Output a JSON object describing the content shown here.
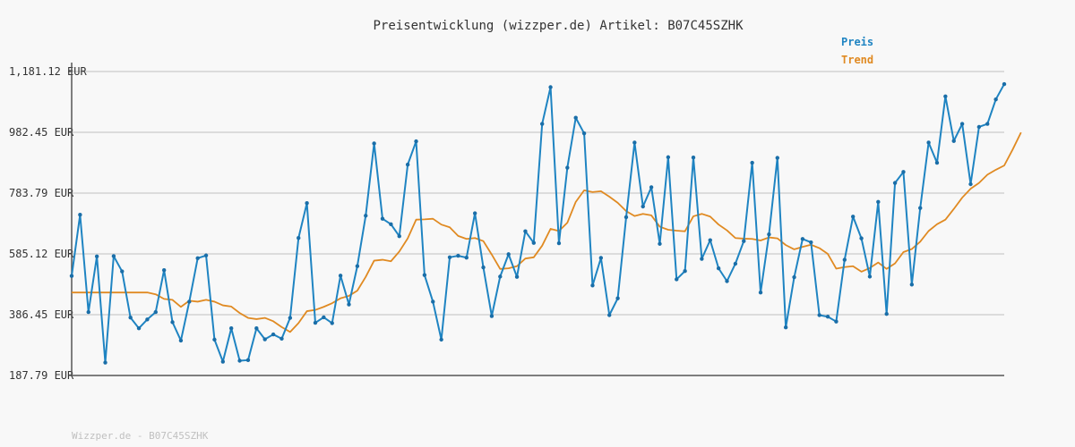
{
  "chart_data": {
    "type": "line",
    "title": "Preisentwicklung (wizzper.de) Artikel: B07C45SZHK",
    "xlabel": "",
    "ylabel": "",
    "ylim": [
      187.79,
      1181.12
    ],
    "yticks": [
      "1,181.12 EUR",
      "982.45 EUR",
      "783.79 EUR",
      "585.12 EUR",
      "386.45 EUR",
      "187.79 EUR"
    ],
    "grid": true,
    "legend": "top-right",
    "footer": "Wizzper.de - B07C45SZHK",
    "series": [
      {
        "name": "Preis",
        "color": "#1f84c2",
        "values": [
          513,
          713,
          395,
          577,
          230,
          578,
          528,
          377,
          342,
          371,
          395,
          532,
          362,
          302,
          429,
          571,
          580,
          305,
          233,
          342,
          236,
          238,
          342,
          306,
          322,
          308,
          376,
          637,
          751,
          360,
          378,
          359,
          514,
          420,
          545,
          710,
          946,
          700,
          682,
          643,
          877,
          953,
          516,
          429,
          305,
          574,
          579,
          573,
          718,
          541,
          382,
          511,
          584,
          510,
          659,
          621,
          1010,
          1130,
          620,
          867,
          1030,
          979,
          482,
          572,
          385,
          440,
          705,
          949,
          740,
          803,
          618,
          901,
          502,
          529,
          900,
          569,
          630,
          538,
          496,
          553,
          627,
          883,
          459,
          649,
          899,
          345,
          509,
          634,
          623,
          385,
          380,
          364,
          566,
          707,
          636,
          511,
          755,
          389,
          817,
          853,
          485,
          735,
          949,
          883,
          1100,
          954,
          1010,
          813,
          1000,
          1010,
          1090,
          1140
        ]
      },
      {
        "name": "Trend",
        "color": "#e08a22",
        "values": [
          459,
          459,
          459,
          459,
          459,
          459,
          459,
          459,
          459,
          459,
          453,
          438,
          435,
          412,
          432,
          429,
          435,
          429,
          417,
          413,
          392,
          376,
          372,
          376,
          365,
          346,
          330,
          359,
          398,
          402,
          412,
          424,
          440,
          448,
          465,
          510,
          563,
          566,
          561,
          593,
          636,
          697,
          698,
          700,
          681,
          672,
          644,
          634,
          637,
          627,
          583,
          536,
          538,
          545,
          570,
          574,
          612,
          667,
          660,
          687,
          755,
          793,
          787,
          790,
          772,
          752,
          725,
          709,
          716,
          711,
          674,
          664,
          661,
          659,
          708,
          716,
          707,
          681,
          662,
          637,
          635,
          634,
          629,
          639,
          636,
          614,
          600,
          608,
          615,
          604,
          585,
          537,
          542,
          545,
          527,
          539,
          557,
          536,
          554,
          591,
          601,
          625,
          660,
          682,
          697,
          732,
          769,
          798,
          817,
          844,
          860,
          874,
          926,
          982
        ]
      }
    ]
  }
}
